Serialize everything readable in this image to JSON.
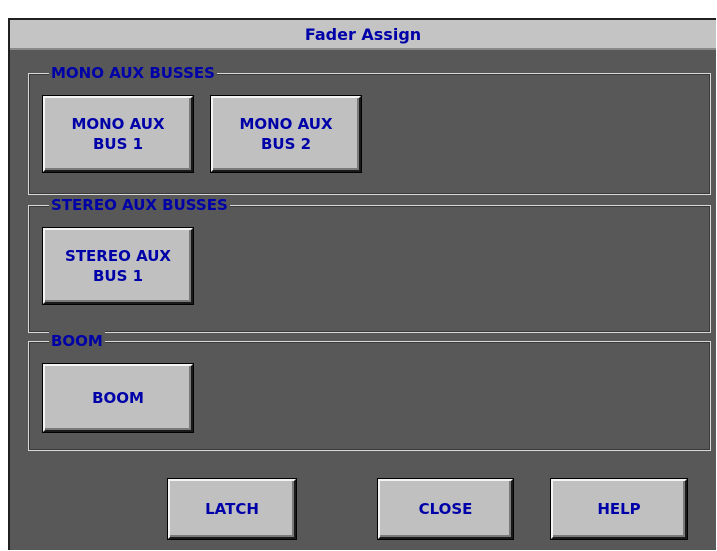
{
  "window": {
    "title": "Fader Assign"
  },
  "groups": {
    "mono": {
      "label": "MONO AUX BUSSES",
      "buttons": [
        "MONO AUX\nBUS 1",
        "MONO AUX\nBUS 2"
      ]
    },
    "stereo": {
      "label": "STEREO AUX BUSSES",
      "buttons": [
        "STEREO AUX\nBUS 1"
      ]
    },
    "boom": {
      "label": "BOOM",
      "buttons": [
        "BOOM"
      ]
    }
  },
  "actions": {
    "latch": "LATCH",
    "close": "CLOSE",
    "help": "HELP"
  },
  "colors": {
    "panel_bg": "#585858",
    "title_bg": "#c4c4c4",
    "button_face": "#c0c0c0",
    "text": "#0000a8"
  }
}
